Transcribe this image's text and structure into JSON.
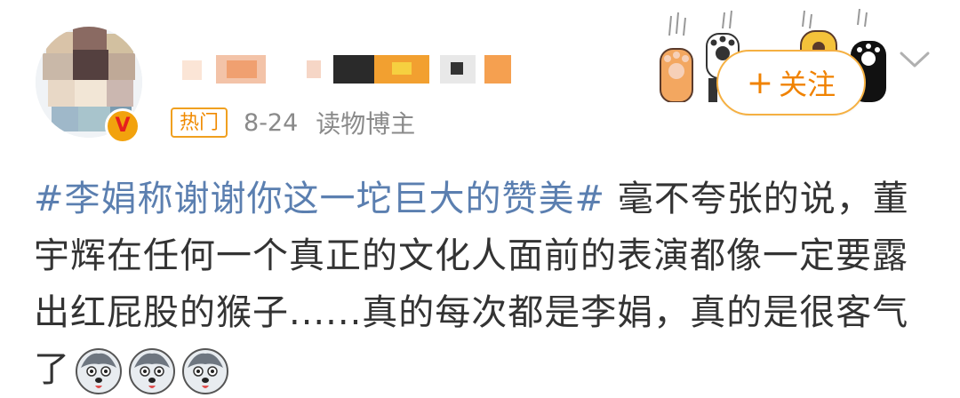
{
  "author": {
    "name": "",
    "badge_label": "热门",
    "date": "8-24",
    "role": "读物博主"
  },
  "follow_button": {
    "label": "关注",
    "icon": "plus-icon"
  },
  "post": {
    "hashtag": "#李娟称谢谢你这一坨巨大的赞美#",
    "body": " 毫不夸张的说，董宇辉在任何一个真正的文化人面前的表演都像一定要露出红屁股的猴子......真的每次都是李娟，真的是很客气了",
    "emojis": [
      "husky-emoji",
      "husky-emoji",
      "husky-emoji"
    ]
  },
  "colors": {
    "accent": "#f08200",
    "hashtag": "#5b7fb0",
    "meta": "#8a8a8a"
  }
}
